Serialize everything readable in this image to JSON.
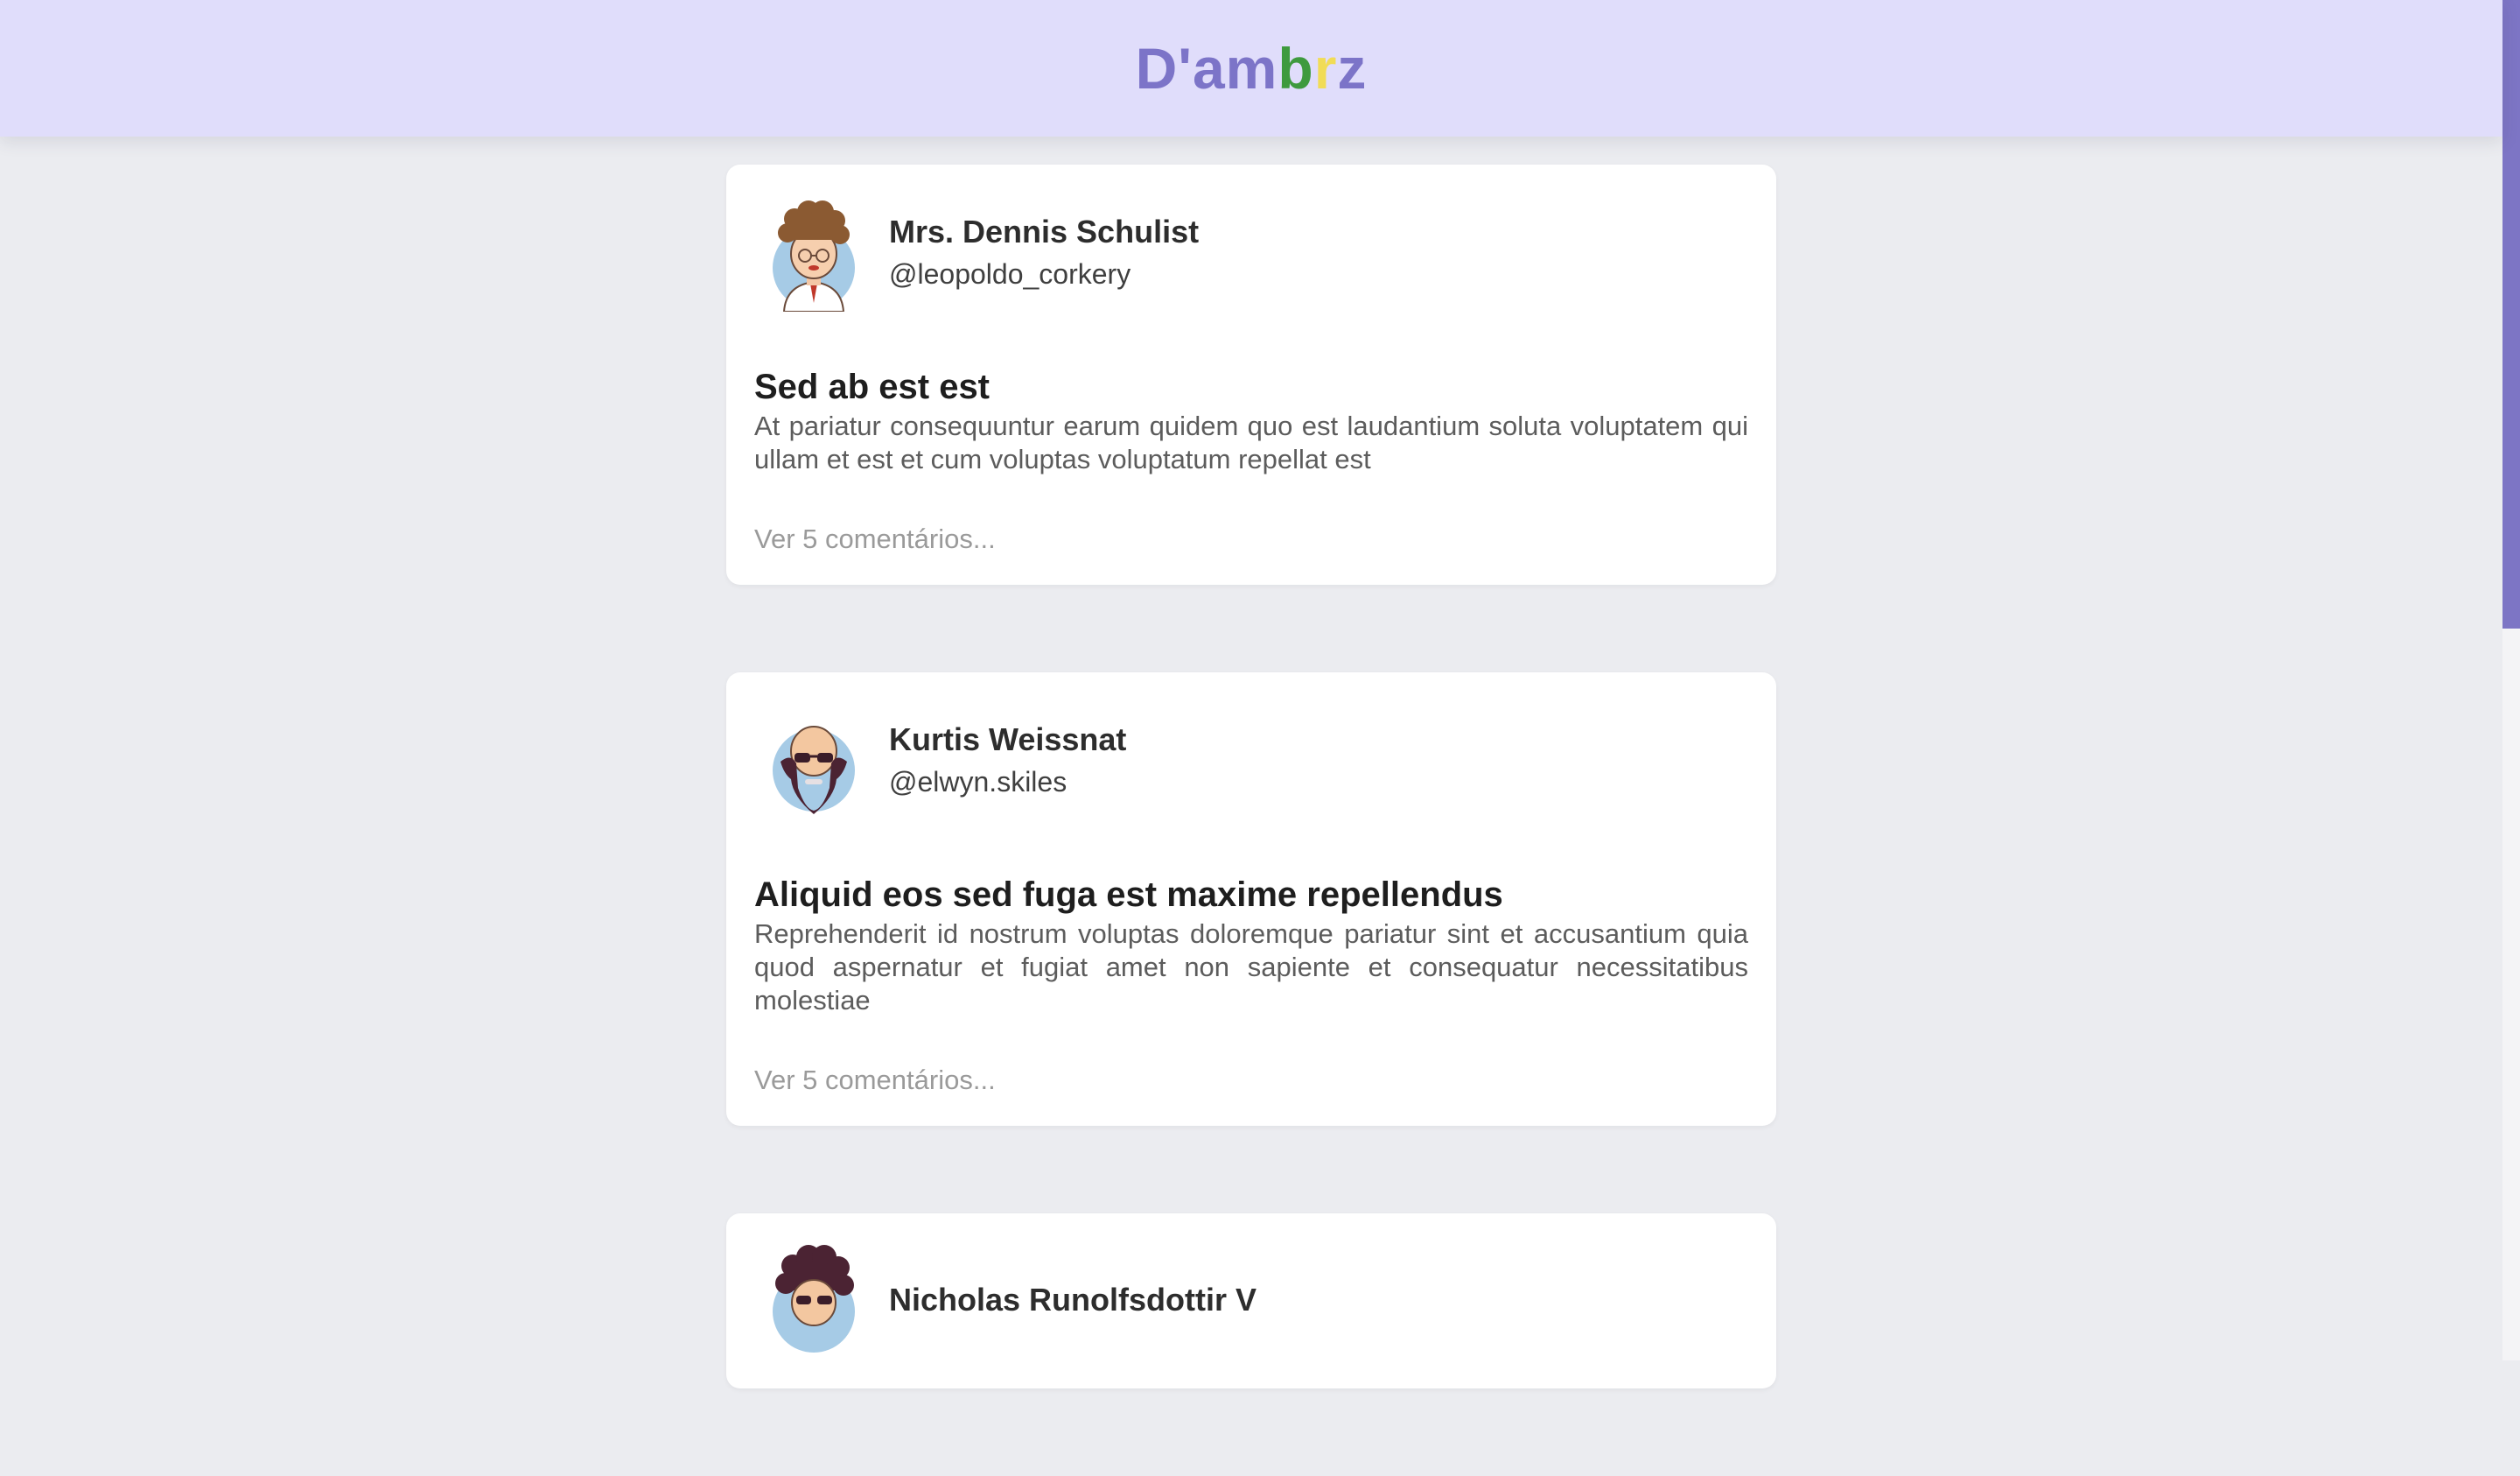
{
  "header": {
    "logo_parts": [
      "D'am",
      "b",
      "r",
      "z"
    ]
  },
  "colors": {
    "header_bg": "#e0ddfb",
    "logo_purple": "#7c74c8",
    "logo_green": "#3e9a3e",
    "logo_yellow": "#f1dc56",
    "page_bg": "#ebecf0",
    "scroll_thumb": "#7d75c5"
  },
  "posts": [
    {
      "author_name": "Mrs. Dennis Schulist",
      "author_handle": "@leopoldo_corkery",
      "avatar_icon": "curly-hair-glasses-avatar-icon",
      "title": "Sed ab est est",
      "body": "At pariatur consequuntur earum quidem quo est laudantium soluta voluptatem qui ullam et est et cum voluptas voluptatum repellat est",
      "comments_label": "Ver 5 comentários..."
    },
    {
      "author_name": "Kurtis Weissnat",
      "author_handle": "@elwyn.skiles",
      "avatar_icon": "bald-bearded-sunglasses-avatar-icon",
      "title": "Aliquid eos sed fuga est maxime repellendus",
      "body": "Reprehenderit id nostrum voluptas doloremque pariatur sint et accusantium quia quod aspernatur et fugiat amet non sapiente et consequatur necessitatibus molestiae",
      "comments_label": "Ver 5 comentários..."
    },
    {
      "author_name": "Nicholas Runolfsdottir V",
      "author_handle": "",
      "avatar_icon": "afro-sunglasses-avatar-icon",
      "title": "",
      "body": "",
      "comments_label": ""
    }
  ]
}
